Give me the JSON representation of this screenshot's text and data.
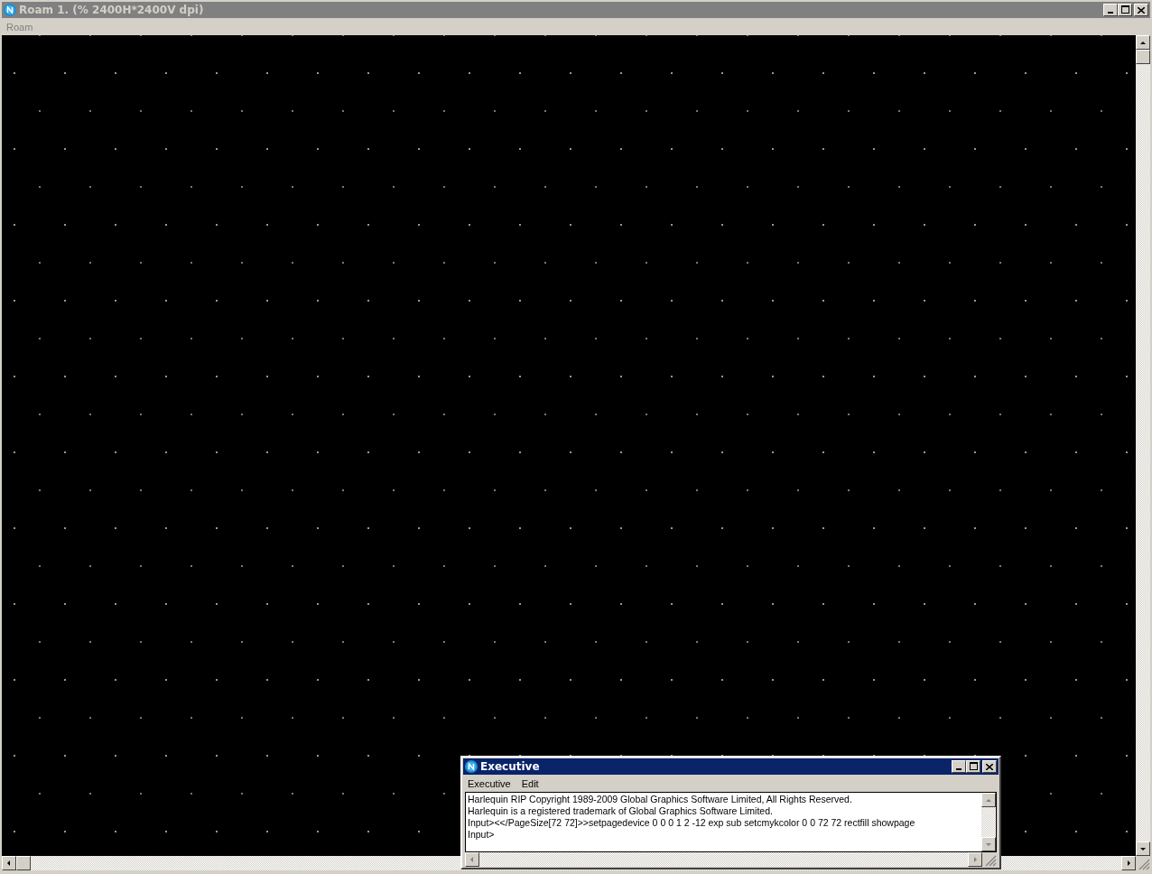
{
  "main_window": {
    "title": "Roam 1. (% 2400H*2400V dpi)",
    "active": false,
    "menu": [
      {
        "label": "Roam",
        "disabled": true
      }
    ]
  },
  "executive_window": {
    "title": "Executive",
    "active": true,
    "menu": [
      {
        "label": "Executive",
        "disabled": false
      },
      {
        "label": "Edit",
        "disabled": false
      }
    ],
    "console_lines": [
      "Harlequin RIP Copyright 1989-2009 Global Graphics Software Limited, All Rights Reserved.",
      "Harlequin is a registered trademark of Global Graphics Software Limited.",
      "Input><</PageSize[72 72]>>setpagedevice 0 0 0 1 2 -12 exp sub setcmykcolor 0 0 72 72 rectfill showpage",
      "Input>"
    ]
  }
}
